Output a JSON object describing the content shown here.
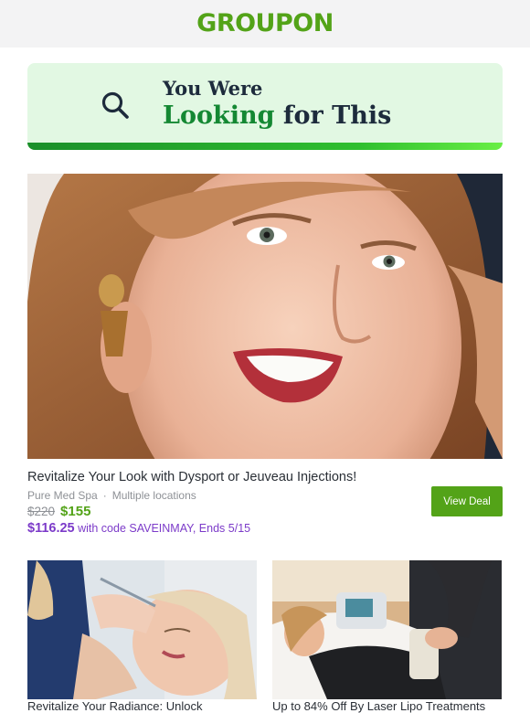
{
  "header": {
    "logo_text": "GROUPON",
    "brand_color": "#53a318"
  },
  "banner": {
    "icon": "search-icon",
    "line1": "You Were",
    "line2_highlight": "Looking",
    "line2_rest": "for This"
  },
  "featured_deal": {
    "image": "woman-smiling-photo",
    "title": "Revitalize Your Look with Dysport or Jeuveau Injections!",
    "merchant": "Pure Med Spa",
    "separator": "·",
    "location": "Multiple locations",
    "original_price": "$220",
    "price": "$155",
    "promo_price": "$116.25",
    "promo_text": "with code SAVEINMAY, Ends 5/15",
    "button_label": "View Deal"
  },
  "more_deals": [
    {
      "image": "injection-treatment-photo",
      "title": "Revitalize Your Radiance: Unlock"
    },
    {
      "image": "laser-treatment-photo",
      "title": "Up to 84% Off By Laser Lipo Treatments"
    }
  ]
}
